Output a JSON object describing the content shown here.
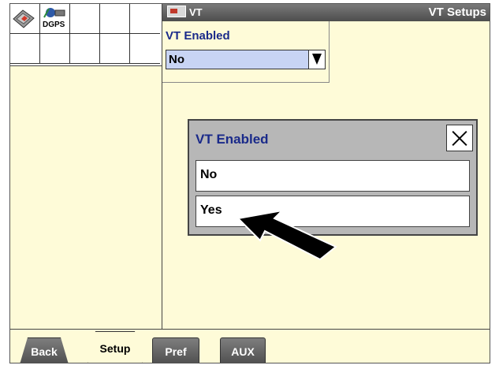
{
  "header": {
    "tag": "VT",
    "title": "VT Setups"
  },
  "shortcuts": {
    "dgps_label": "DGPS"
  },
  "setting": {
    "label": "VT Enabled",
    "value": "No"
  },
  "popup": {
    "title": "VT Enabled",
    "options": [
      "No",
      "Yes"
    ]
  },
  "tabs": {
    "back": "Back",
    "setup": "Setup",
    "pref": "Pref",
    "aux": "AUX"
  }
}
